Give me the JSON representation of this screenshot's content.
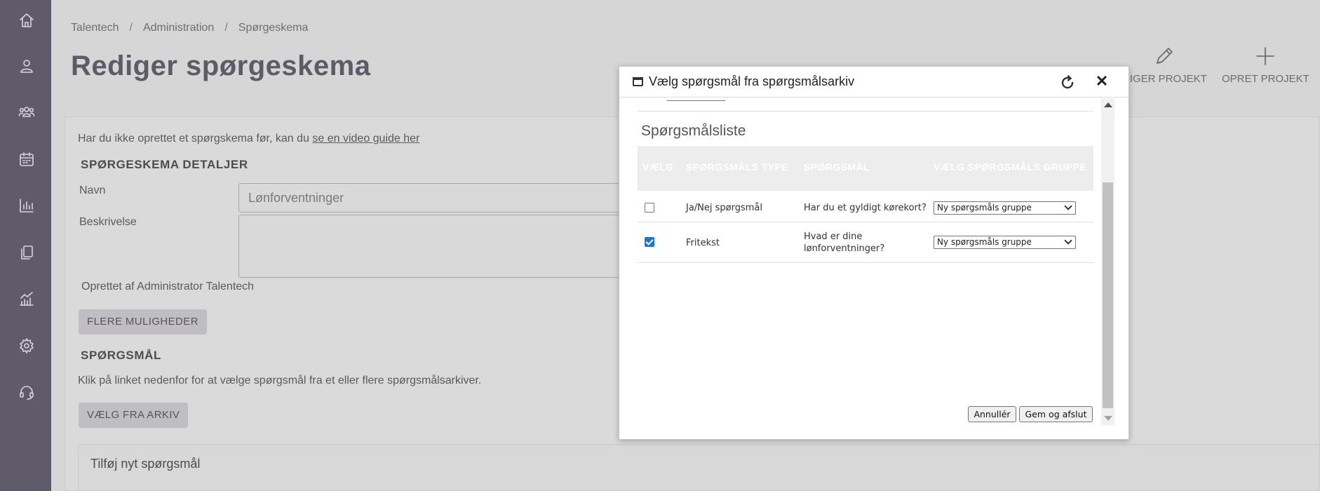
{
  "sidebar": {
    "items": [
      {
        "icon": "home-icon"
      },
      {
        "icon": "user-icon"
      },
      {
        "icon": "group-icon"
      },
      {
        "icon": "calendar-icon"
      },
      {
        "icon": "bar-chart-icon"
      },
      {
        "icon": "copy-icon"
      },
      {
        "icon": "analytics-icon"
      },
      {
        "icon": "gear-icon"
      },
      {
        "icon": "headset-icon"
      }
    ]
  },
  "breadcrumb": [
    "Talentech",
    "Administration",
    "Spørgeskema"
  ],
  "page_title": "Rediger spørgeskema",
  "top_actions": {
    "edit_project": "DIGER PROJEKT",
    "create_project": "OPRET PROJEKT"
  },
  "intro": {
    "text": "Har du ikke oprettet et spørgskema før, kan du ",
    "link": "se en video guide her"
  },
  "details": {
    "heading": "SPØRGESKEMA DETALJER",
    "name_label": "Navn",
    "name_value": "Lønforventninger",
    "description_label": "Beskrivelse",
    "created_by": "Oprettet af Administrator Talentech",
    "more_options": "FLERE MULIGHEDER"
  },
  "questions": {
    "heading": "SPØRGSMÅL",
    "instruction": "Klik på linket nedenfor for at vælge spørgsmål fra et eller flere spørgsmålsarkiver.",
    "choose_from_archive": "VÆLG FRA ARKIV",
    "add_new": "Tilføj nyt spørgsmål"
  },
  "dialog": {
    "title": "Vælg spørgsmål fra spørgsmålsarkiv",
    "list_title": "Spørgsmålsliste",
    "columns": [
      "VÆLG",
      "SPØRGSMÅLS TYPE",
      "SPØRGSMÅL",
      "VÆLG SPØRGSMÅLS GRUPPE"
    ],
    "rows": [
      {
        "checked": false,
        "type": "Ja/Nej spørgsmål",
        "question": "Har du et gyldigt kørekort?",
        "group": "Ny spørgsmåls gruppe"
      },
      {
        "checked": true,
        "type": "Fritekst",
        "question": "Hvad er dine lønforventninger?",
        "group": "Ny spørgsmåls gruppe"
      }
    ],
    "cancel": "Annullér",
    "save": "Gem og afslut"
  }
}
